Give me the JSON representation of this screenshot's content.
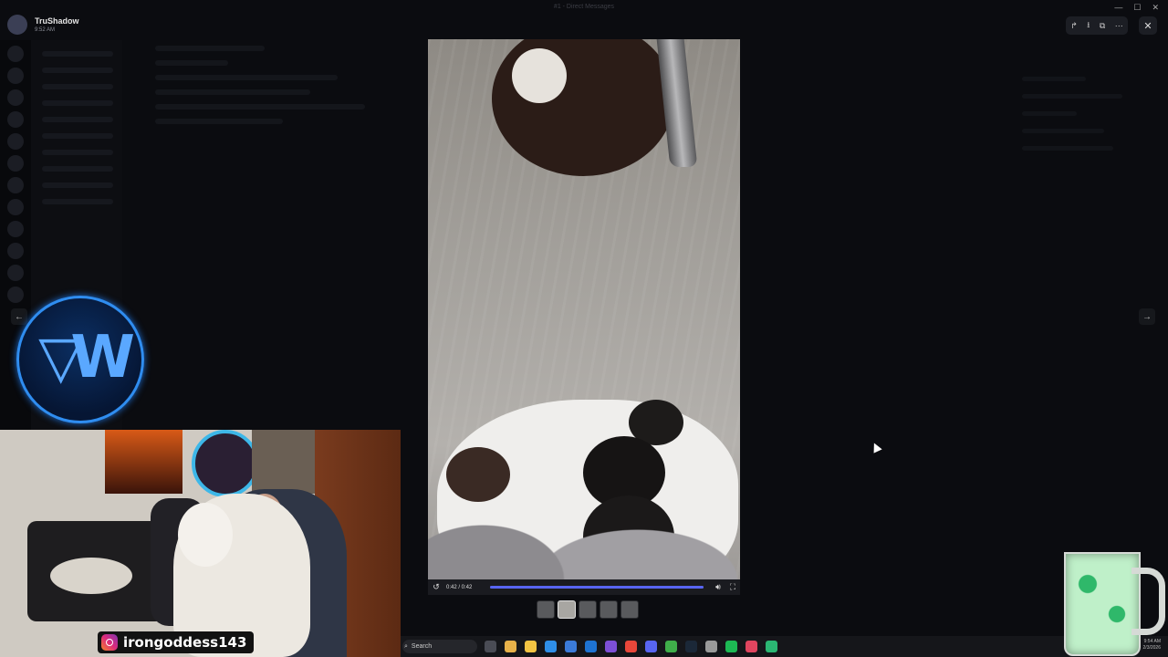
{
  "window": {
    "title": "#1 - Direct Messages"
  },
  "header": {
    "username": "TruShadow",
    "timestamp": "9:52 AM"
  },
  "toolbar": {
    "forward_icon": "forward-icon",
    "download_icon": "download-icon",
    "open_icon": "open-external-icon",
    "more_icon": "more-icon",
    "close_icon": "close-icon"
  },
  "video": {
    "current_time": "0:42 / 0:42",
    "progress": 1.0,
    "accent_color": "#5865f2"
  },
  "gallery": {
    "count": 5,
    "active_index": 1
  },
  "overlay": {
    "instagram_handle": "irongoddess143"
  },
  "taskbar": {
    "search_placeholder": "Search",
    "icons": [
      "task-view-icon",
      "copilot-icon",
      "file-explorer-icon",
      "edge-icon",
      "store-icon",
      "outlook-icon",
      "proton-icon",
      "chrome-icon",
      "discord-icon",
      "xbox-icon",
      "steam-icon",
      "settings-icon",
      "spotify-icon",
      "maps-icon",
      "app-icon"
    ],
    "clock_time": "9:54 AM",
    "clock_date": "2/3/2026"
  }
}
